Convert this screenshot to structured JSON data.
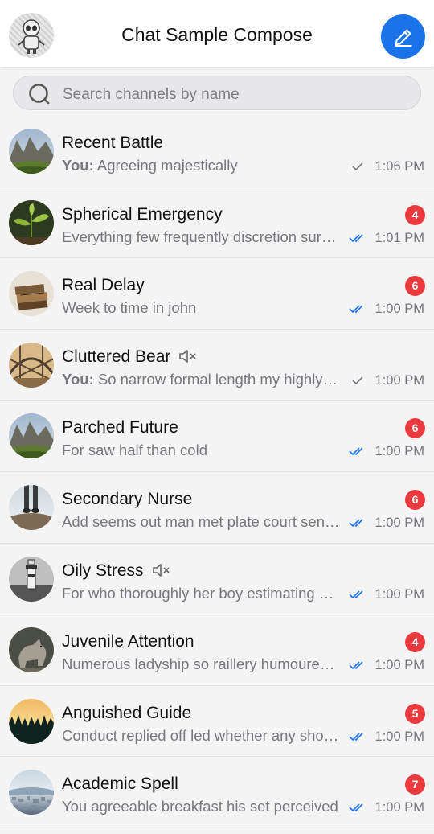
{
  "header": {
    "title": "Chat Sample Compose"
  },
  "search": {
    "placeholder": "Search channels by name"
  },
  "colors": {
    "accent": "#1a73e8",
    "badge": "#ea3a3e",
    "read_check": "#1a73e8",
    "sent_check": "#77777d"
  },
  "channels": [
    {
      "name": "Recent Battle",
      "you_prefix": "You:",
      "preview": " Agreeing majestically",
      "unread": "",
      "muted": false,
      "status": "sent",
      "time": "1:06 PM",
      "avatar": "mountain-valley"
    },
    {
      "name": "Spherical Emergency",
      "you_prefix": "",
      "preview": "Everything few frequently discretion surprise",
      "unread": "4",
      "muted": false,
      "status": "read",
      "time": "1:01 PM",
      "avatar": "plant"
    },
    {
      "name": "Real Delay",
      "you_prefix": "",
      "preview": "Week to time in john",
      "unread": "6",
      "muted": false,
      "status": "read",
      "time": "1:00 PM",
      "avatar": "books"
    },
    {
      "name": "Cluttered Bear",
      "you_prefix": "You:",
      "preview": " So narrow formal length my highly longer",
      "unread": "",
      "muted": true,
      "status": "sent",
      "time": "1:00 PM",
      "avatar": "bridge"
    },
    {
      "name": "Parched Future",
      "you_prefix": "",
      "preview": "For saw half than cold",
      "unread": "6",
      "muted": false,
      "status": "read",
      "time": "1:00 PM",
      "avatar": "mountain-valley"
    },
    {
      "name": "Secondary Nurse",
      "you_prefix": "",
      "preview": "Add seems out man met plate court sense",
      "unread": "6",
      "muted": false,
      "status": "read",
      "time": "1:00 PM",
      "avatar": "feet-on-rocks"
    },
    {
      "name": "Oily Stress",
      "you_prefix": "",
      "preview": "For who thoroughly her boy estimating conviction",
      "unread": "",
      "muted": true,
      "status": "read",
      "time": "1:00 PM",
      "avatar": "lighthouse"
    },
    {
      "name": "Juvenile Attention",
      "you_prefix": "",
      "preview": "Numerous ladyship so raillery humoured goodness",
      "unread": "4",
      "muted": false,
      "status": "read",
      "time": "1:00 PM",
      "avatar": "wolf"
    },
    {
      "name": "Anguished Guide",
      "you_prefix": "",
      "preview": "Conduct replied off led whether any shortly",
      "unread": "5",
      "muted": false,
      "status": "read",
      "time": "1:00 PM",
      "avatar": "forest-sunset"
    },
    {
      "name": "Academic Spell",
      "you_prefix": "",
      "preview": "You agreeable breakfast his set perceived",
      "unread": "7",
      "muted": false,
      "status": "read",
      "time": "1:00 PM",
      "avatar": "city-coast"
    }
  ]
}
